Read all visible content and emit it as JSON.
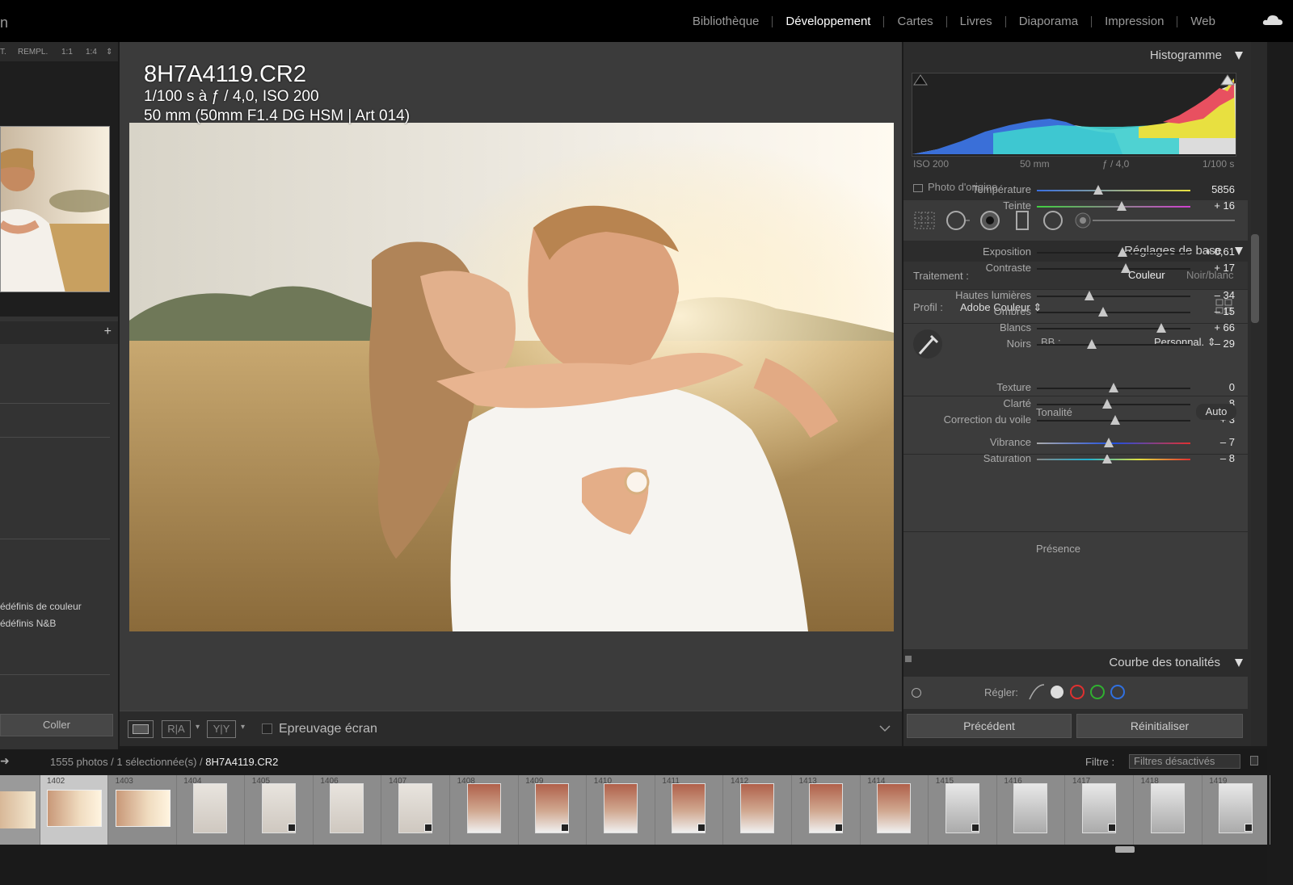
{
  "app": {
    "logo_fragment": "n",
    "modules": [
      {
        "label": "Bibliothèque",
        "active": false
      },
      {
        "label": "Développement",
        "active": true
      },
      {
        "label": "Cartes",
        "active": false
      },
      {
        "label": "Livres",
        "active": false
      },
      {
        "label": "Diaporama",
        "active": false
      },
      {
        "label": "Impression",
        "active": false
      },
      {
        "label": "Web",
        "active": false
      }
    ]
  },
  "navigator": {
    "fit": "T.",
    "fill": "REMPL.",
    "z11": "1:1",
    "z14": "1:4"
  },
  "left": {
    "presets_add": "+",
    "preset_items": [
      "édéfinis de couleur",
      "édéfinis N&B"
    ],
    "paste_button": "Coller"
  },
  "photo": {
    "filename": "8H7A4119.CR2",
    "exposure_line": "1/100 s à ƒ / 4,0, ISO 200",
    "lens_line": "50 mm (50mm F1.4 DG HSM | Art 014)"
  },
  "toolbar": {
    "ra_label": "R|A",
    "yy_label": "Y|Y",
    "proof_label": "Epreuvage écran"
  },
  "histogram": {
    "title": "Histogramme",
    "iso": "ISO 200",
    "focal": "50 mm",
    "aperture": "ƒ / 4,0",
    "shutter": "1/100 s",
    "original_label": "Photo d'origine"
  },
  "basic": {
    "title": "Réglages de base",
    "treatment_label": "Traitement :",
    "treatment_color": "Couleur",
    "treatment_bw": "Noir/blanc",
    "profile_label": "Profil :",
    "profile_value": "Adobe Couleur",
    "wb_label": "BB :",
    "wb_value": "Personnal.",
    "tone_title": "Tonalité",
    "auto_label": "Auto",
    "presence_title": "Présence",
    "sliders": [
      {
        "label": "Température",
        "value": "5856",
        "pos": 0.4
      },
      {
        "label": "Teinte",
        "value": "+ 16",
        "pos": 0.55
      },
      {
        "label": "Exposition",
        "value": "+ 0,61",
        "pos": 0.56
      },
      {
        "label": "Contraste",
        "value": "+ 17",
        "pos": 0.58
      },
      {
        "label": "Hautes lumières",
        "value": "– 34",
        "pos": 0.34
      },
      {
        "label": "Ombres",
        "value": "– 15",
        "pos": 0.43
      },
      {
        "label": "Blancs",
        "value": "+ 66",
        "pos": 0.81
      },
      {
        "label": "Noirs",
        "value": "– 29",
        "pos": 0.36
      },
      {
        "label": "Texture",
        "value": "0",
        "pos": 0.5
      },
      {
        "label": "Clarté",
        "value": "– 8",
        "pos": 0.46
      },
      {
        "label": "Correction du voile",
        "value": "+ 3",
        "pos": 0.51
      },
      {
        "label": "Vibrance",
        "value": "– 7",
        "pos": 0.47
      },
      {
        "label": "Saturation",
        "value": "– 8",
        "pos": 0.46
      }
    ]
  },
  "curve": {
    "title": "Courbe des tonalités",
    "adjust_label": "Régler:"
  },
  "buttons": {
    "previous": "Précédent",
    "reset": "Réinitialiser"
  },
  "filmstrip": {
    "count_text": "1555 photos / 1 sélectionnée(s) / ",
    "current_file": "8H7A4119.CR2",
    "filter_label": "Filtre :",
    "filter_value": "Filtres désactivés",
    "numbers": [
      "1402",
      "1403",
      "1404",
      "1405",
      "1406",
      "1407",
      "1408",
      "1409",
      "1410",
      "1411",
      "1412",
      "1413",
      "1414",
      "1415",
      "1416",
      "1417",
      "1418",
      "1419"
    ]
  },
  "colors": {
    "accent_active": "#ffffff",
    "panel_bg": "#3c3c3c",
    "histogram_blue": "#3a6fd8",
    "histogram_cyan": "#3fd0d0",
    "histogram_yellow": "#e8e040",
    "histogram_red": "#e85060"
  }
}
